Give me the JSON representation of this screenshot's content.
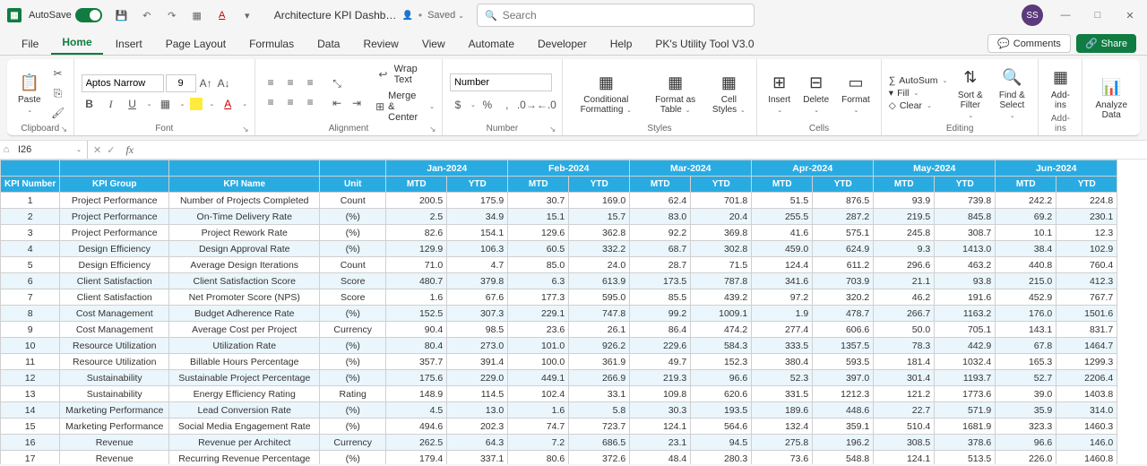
{
  "titlebar": {
    "autosave": "AutoSave",
    "doc_title": "Architecture KPI Dashb…",
    "saved": "Saved",
    "search_placeholder": "Search",
    "avatar": "SS"
  },
  "tabs": {
    "items": [
      "File",
      "Home",
      "Insert",
      "Page Layout",
      "Formulas",
      "Data",
      "Review",
      "View",
      "Automate",
      "Developer",
      "Help",
      "PK's Utility Tool V3.0"
    ],
    "active": 1,
    "comments": "Comments",
    "share": "Share"
  },
  "ribbon": {
    "clipboard": {
      "paste": "Paste",
      "label": "Clipboard"
    },
    "font": {
      "name": "Aptos Narrow",
      "size": "9",
      "label": "Font"
    },
    "alignment": {
      "wrap": "Wrap Text",
      "merge": "Merge & Center",
      "label": "Alignment"
    },
    "number": {
      "format": "Number",
      "label": "Number"
    },
    "styles": {
      "cond": "Conditional Formatting",
      "table": "Format as Table",
      "cell": "Cell Styles",
      "label": "Styles"
    },
    "cells": {
      "insert": "Insert",
      "delete": "Delete",
      "format": "Format",
      "label": "Cells"
    },
    "editing": {
      "autosum": "AutoSum",
      "fill": "Fill",
      "clear": "Clear",
      "sort": "Sort & Filter",
      "find": "Find & Select",
      "label": "Editing"
    },
    "addins": {
      "addins": "Add-ins",
      "label": "Add-ins"
    },
    "analyze": {
      "analyze": "Analyze Data"
    }
  },
  "namebox": "I26",
  "months": [
    "Jan-2024",
    "Feb-2024",
    "Mar-2024",
    "Apr-2024",
    "May-2024",
    "Jun-2024"
  ],
  "headers": {
    "kpi_num": "KPI Number",
    "kpi_group": "KPI Group",
    "kpi_name": "KPI Name",
    "unit": "Unit",
    "mtd": "MTD",
    "ytd": "YTD"
  },
  "rows": [
    {
      "n": "1",
      "g": "Project Performance",
      "name": "Number of Projects Completed",
      "u": "Count",
      "v": [
        "200.5",
        "175.9",
        "30.7",
        "169.0",
        "62.4",
        "701.8",
        "51.5",
        "876.5",
        "93.9",
        "739.8",
        "242.2",
        "224.8"
      ]
    },
    {
      "n": "2",
      "g": "Project Performance",
      "name": "On-Time Delivery Rate",
      "u": "(%)",
      "v": [
        "2.5",
        "34.9",
        "15.1",
        "15.7",
        "83.0",
        "20.4",
        "255.5",
        "287.2",
        "219.5",
        "845.8",
        "69.2",
        "230.1"
      ]
    },
    {
      "n": "3",
      "g": "Project Performance",
      "name": "Project Rework Rate",
      "u": "(%)",
      "v": [
        "82.6",
        "154.1",
        "129.6",
        "362.8",
        "92.2",
        "369.8",
        "41.6",
        "575.1",
        "245.8",
        "308.7",
        "10.1",
        "12.3"
      ]
    },
    {
      "n": "4",
      "g": "Design Efficiency",
      "name": "Design Approval Rate",
      "u": "(%)",
      "v": [
        "129.9",
        "106.3",
        "60.5",
        "332.2",
        "68.7",
        "302.8",
        "459.0",
        "624.9",
        "9.3",
        "1413.0",
        "38.4",
        "102.9"
      ]
    },
    {
      "n": "5",
      "g": "Design Efficiency",
      "name": "Average Design Iterations",
      "u": "Count",
      "v": [
        "71.0",
        "4.7",
        "85.0",
        "24.0",
        "28.7",
        "71.5",
        "124.4",
        "611.2",
        "296.6",
        "463.2",
        "440.8",
        "760.4"
      ]
    },
    {
      "n": "6",
      "g": "Client Satisfaction",
      "name": "Client Satisfaction Score",
      "u": "Score",
      "v": [
        "480.7",
        "379.8",
        "6.3",
        "613.9",
        "173.5",
        "787.8",
        "341.6",
        "703.9",
        "21.1",
        "93.8",
        "215.0",
        "412.3"
      ]
    },
    {
      "n": "7",
      "g": "Client Satisfaction",
      "name": "Net Promoter Score (NPS)",
      "u": "Score",
      "v": [
        "1.6",
        "67.6",
        "177.3",
        "595.0",
        "85.5",
        "439.2",
        "97.2",
        "320.2",
        "46.2",
        "191.6",
        "452.9",
        "767.7"
      ]
    },
    {
      "n": "8",
      "g": "Cost Management",
      "name": "Budget Adherence Rate",
      "u": "(%)",
      "v": [
        "152.5",
        "307.3",
        "229.1",
        "747.8",
        "99.2",
        "1009.1",
        "1.9",
        "478.7",
        "266.7",
        "1163.2",
        "176.0",
        "1501.6"
      ]
    },
    {
      "n": "9",
      "g": "Cost Management",
      "name": "Average Cost per Project",
      "u": "Currency",
      "v": [
        "90.4",
        "98.5",
        "23.6",
        "26.1",
        "86.4",
        "474.2",
        "277.4",
        "606.6",
        "50.0",
        "705.1",
        "143.1",
        "831.7"
      ]
    },
    {
      "n": "10",
      "g": "Resource Utilization",
      "name": "Utilization Rate",
      "u": "(%)",
      "v": [
        "80.4",
        "273.0",
        "101.0",
        "926.2",
        "229.6",
        "584.3",
        "333.5",
        "1357.5",
        "78.3",
        "442.9",
        "67.8",
        "1464.7"
      ]
    },
    {
      "n": "11",
      "g": "Resource Utilization",
      "name": "Billable Hours Percentage",
      "u": "(%)",
      "v": [
        "357.7",
        "391.4",
        "100.0",
        "361.9",
        "49.7",
        "152.3",
        "380.4",
        "593.5",
        "181.4",
        "1032.4",
        "165.3",
        "1299.3"
      ]
    },
    {
      "n": "12",
      "g": "Sustainability",
      "name": "Sustainable Project Percentage",
      "u": "(%)",
      "v": [
        "175.6",
        "229.0",
        "449.1",
        "266.9",
        "219.3",
        "96.6",
        "52.3",
        "397.0",
        "301.4",
        "1193.7",
        "52.7",
        "2206.4"
      ]
    },
    {
      "n": "13",
      "g": "Sustainability",
      "name": "Energy Efficiency Rating",
      "u": "Rating",
      "v": [
        "148.9",
        "114.5",
        "102.4",
        "33.1",
        "109.8",
        "620.6",
        "331.5",
        "1212.3",
        "121.2",
        "1773.6",
        "39.0",
        "1403.8"
      ]
    },
    {
      "n": "14",
      "g": "Marketing Performance",
      "name": "Lead Conversion Rate",
      "u": "(%)",
      "v": [
        "4.5",
        "13.0",
        "1.6",
        "5.8",
        "30.3",
        "193.5",
        "189.6",
        "448.6",
        "22.7",
        "571.9",
        "35.9",
        "314.0"
      ]
    },
    {
      "n": "15",
      "g": "Marketing Performance",
      "name": "Social Media Engagement Rate",
      "u": "(%)",
      "v": [
        "494.6",
        "202.3",
        "74.7",
        "723.7",
        "124.1",
        "564.6",
        "132.4",
        "359.1",
        "510.4",
        "1681.9",
        "323.3",
        "1460.3"
      ]
    },
    {
      "n": "16",
      "g": "Revenue",
      "name": "Revenue per Architect",
      "u": "Currency",
      "v": [
        "262.5",
        "64.3",
        "7.2",
        "686.5",
        "23.1",
        "94.5",
        "275.8",
        "196.2",
        "308.5",
        "378.6",
        "96.6",
        "146.0"
      ]
    },
    {
      "n": "17",
      "g": "Revenue",
      "name": "Recurring Revenue Percentage",
      "u": "(%)",
      "v": [
        "179.4",
        "337.1",
        "80.6",
        "372.6",
        "48.4",
        "280.3",
        "73.6",
        "548.8",
        "124.1",
        "513.5",
        "226.0",
        "1460.8"
      ]
    }
  ]
}
